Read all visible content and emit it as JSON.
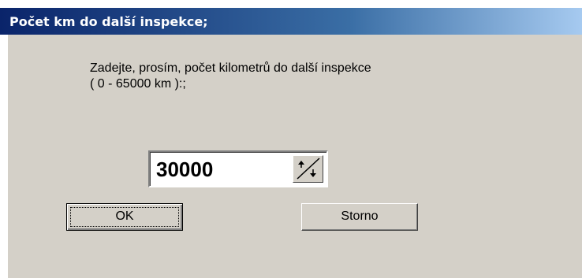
{
  "dialog": {
    "title": "Počet km do další inspekce;",
    "prompt_line1": "Zadejte, prosím, počet kilometrů do další inspekce",
    "prompt_line2": "( 0 - 65000 km ):;",
    "spin_value": "30000",
    "ok_label": "OK",
    "cancel_label": "Storno"
  },
  "colors": {
    "face": "#d4d0c8",
    "title_start": "#0a246a",
    "title_end": "#a6caf0"
  },
  "icons": {
    "spin": "up-down-arrows-icon"
  }
}
